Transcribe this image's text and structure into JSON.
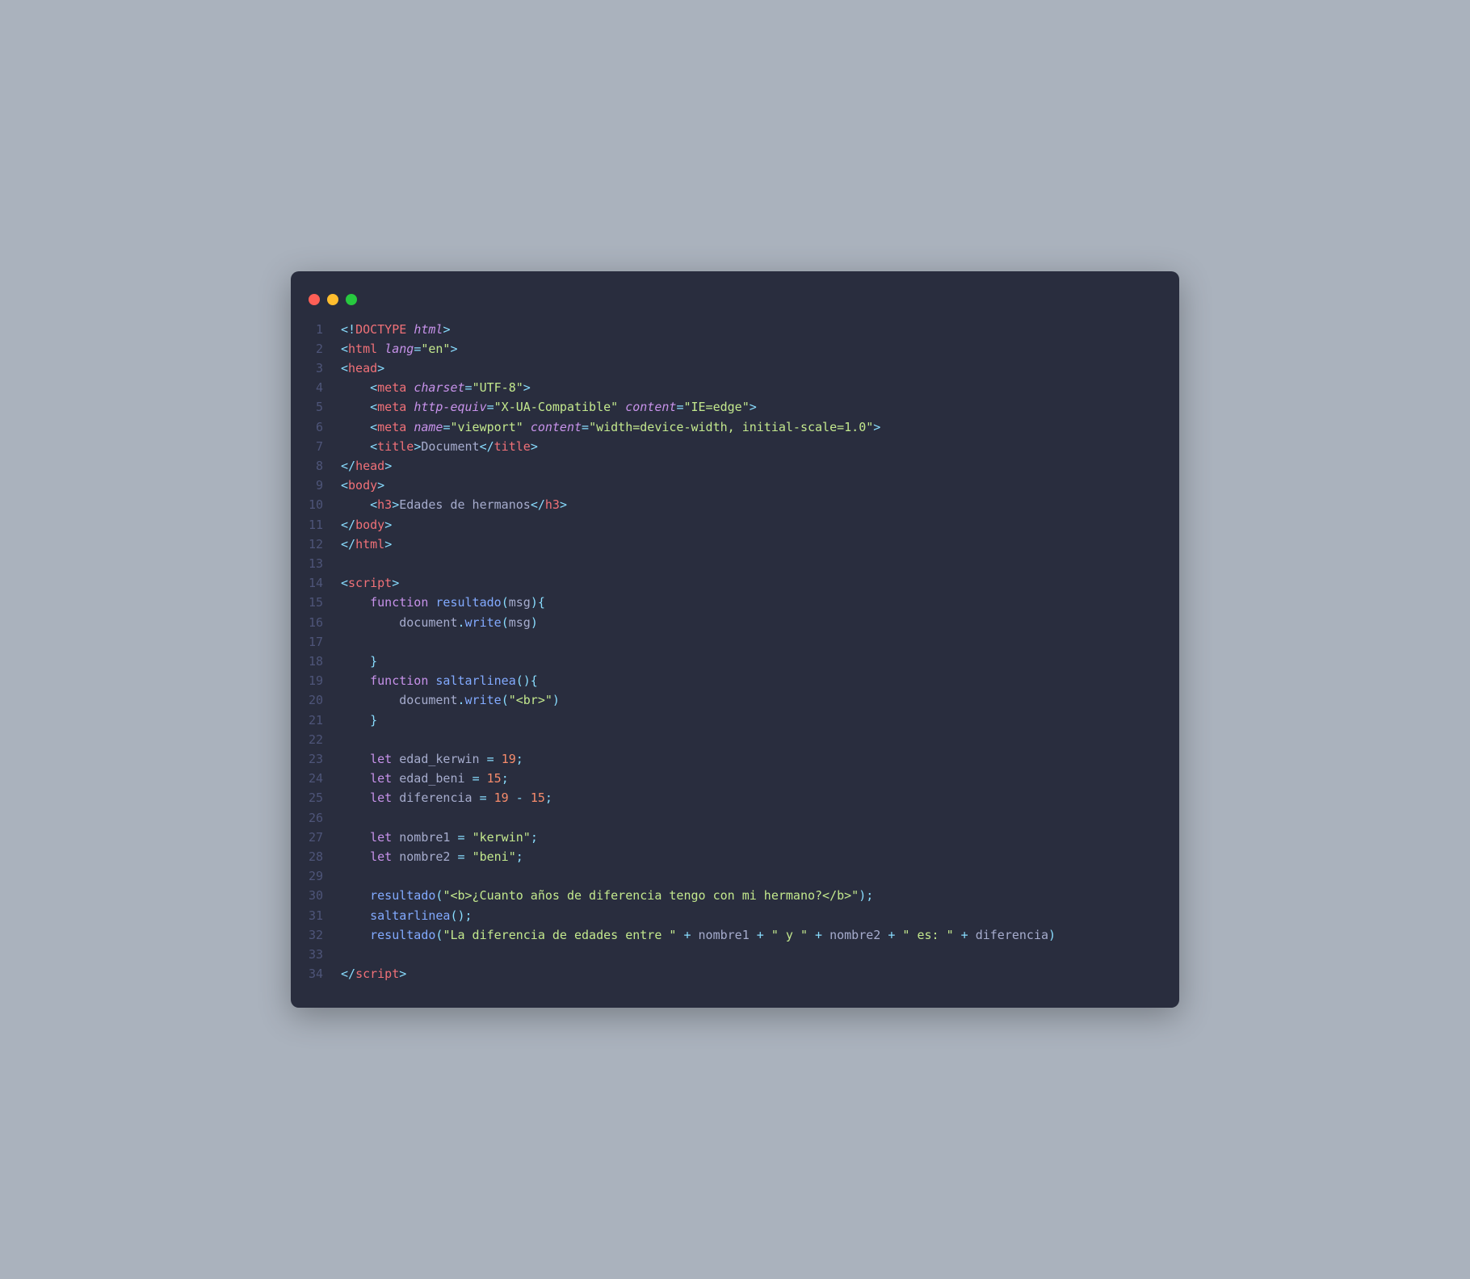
{
  "window": {
    "traffic_lights": [
      "red",
      "yellow",
      "green"
    ]
  },
  "gutter": {
    "start": 1,
    "end": 34
  },
  "code": {
    "doctype_kw": "DOCTYPE",
    "doctype_val": "html",
    "html_tag": "html",
    "lang_attr": "lang",
    "lang_val": "\"en\"",
    "head_tag": "head",
    "meta_tag": "meta",
    "charset_attr": "charset",
    "charset_val": "\"UTF-8\"",
    "httpequiv_attr": "http-equiv",
    "httpequiv_val": "\"X-UA-Compatible\"",
    "content_attr": "content",
    "iecontent_val": "\"IE=edge\"",
    "name_attr": "name",
    "viewport_val": "\"viewport\"",
    "viewportcontent_val": "\"width=device-width, initial-scale=1.0\"",
    "title_tag": "title",
    "title_text": "Document",
    "body_tag": "body",
    "h3_tag": "h3",
    "h3_text": "Edades de hermanos",
    "script_tag": "script",
    "fn_kw": "function",
    "fn1_name": "resultado",
    "fn1_param": "msg",
    "docwrite_obj": "document",
    "docwrite_fn": "write",
    "fn2_name": "saltarlinea",
    "br_str": "\"<br>\"",
    "let_kw": "let",
    "var1": "edad_kerwin",
    "val1": "19",
    "var2": "edad_beni",
    "val2": "15",
    "var3": "diferencia",
    "val3a": "19",
    "val3b": "15",
    "var4": "nombre1",
    "val4": "\"kerwin\"",
    "var5": "nombre2",
    "val5": "\"beni\"",
    "call1_arg": "\"<b>¿Cuanto años de diferencia tengo con mi hermano?</b>\"",
    "call3_s1": "\"La diferencia de edades entre \"",
    "call3_s2": "\" y \"",
    "call3_s3": "\" es: \""
  }
}
